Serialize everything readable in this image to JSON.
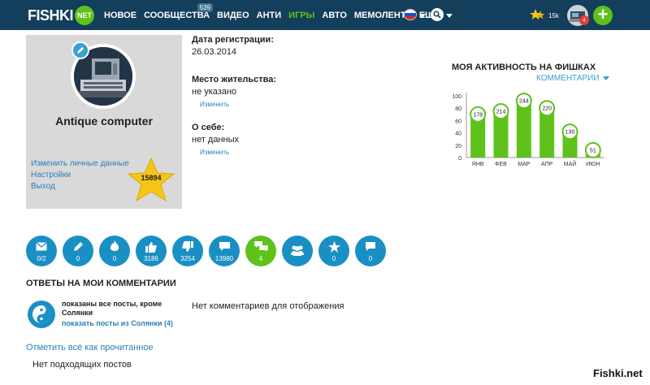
{
  "header": {
    "logo_text": "FISHKI",
    "logo_badge": "NET",
    "nav": [
      {
        "label": "НОВОЕ",
        "active": false
      },
      {
        "label": "СООБЩЕСТВА",
        "active": false,
        "badge": "539"
      },
      {
        "label": "ВИДЕО",
        "active": false
      },
      {
        "label": "АНТИ",
        "active": false
      },
      {
        "label": "ИГРЫ",
        "active": true
      },
      {
        "label": "АВТО",
        "active": false
      },
      {
        "label": "МЕМОЛЕНТА",
        "active": false
      },
      {
        "label": "ЕЩЁ",
        "active": false
      }
    ],
    "stars_count": "15k",
    "notifications_count": "4",
    "add_label": "+"
  },
  "profile": {
    "username": "Antique computer",
    "links": [
      "Изменить личные данные",
      "Настройки",
      "Выход"
    ],
    "rating": "15894"
  },
  "info": {
    "registration_label": "Дата регистрации:",
    "registration_value": "26.03.2014",
    "location_label": "Место жительства:",
    "location_value": "не указано",
    "location_edit": "Изменить",
    "about_label": "О себе:",
    "about_value": "нет данных",
    "about_edit": "Изменить"
  },
  "activity": {
    "title": "МОЯ АКТИВНОСТЬ НА ФИШКАХ",
    "filter": "КОММЕНТАРИИ"
  },
  "chart_data": {
    "type": "bar",
    "categories": [
      "ЯНВ",
      "ФЕВ",
      "МАР",
      "АПР",
      "МАЙ",
      "ИЮН"
    ],
    "values": [
      178,
      214,
      244,
      220,
      130,
      51
    ],
    "display_heights": [
      70,
      75,
      92,
      80,
      42,
      12
    ],
    "yticks": [
      0,
      20,
      40,
      60,
      80,
      100
    ],
    "ylim": [
      0,
      100
    ],
    "bar_color": "#5fc21a"
  },
  "stats": [
    {
      "icon": "envelope-icon",
      "value": "0/2",
      "active": false
    },
    {
      "icon": "pen-icon",
      "value": "0",
      "active": false
    },
    {
      "icon": "flame-icon",
      "value": "0",
      "active": false
    },
    {
      "icon": "thumbs-up-icon",
      "value": "3186",
      "active": false
    },
    {
      "icon": "thumbs-down-icon",
      "value": "3254",
      "active": false
    },
    {
      "icon": "comment-icon",
      "value": "13980",
      "active": false
    },
    {
      "icon": "comments-icon",
      "value": "4",
      "active": true
    },
    {
      "icon": "users-icon",
      "value": "",
      "active": false
    },
    {
      "icon": "star-icon",
      "value": "0",
      "active": false
    },
    {
      "icon": "speech-bubble-icon",
      "value": "0",
      "active": false
    }
  ],
  "replies": {
    "title": "ОТВЕТЫ НА МОИ КОММЕНТАРИИ",
    "filter_text": "показаны все посты, кроме Солянки",
    "filter_link": "показать посты из Солянки (4)",
    "no_comments": "Нет комментариев для отображения",
    "mark_read": "Отметить всё как прочитанное",
    "no_posts": "Нет подходящих постов"
  },
  "watermark": "Fishki.net",
  "colors": {
    "header_bg": "#133e5c",
    "accent_green": "#5fc21a",
    "accent_blue": "#1a8fc4",
    "link_blue": "#2a7fb8"
  }
}
